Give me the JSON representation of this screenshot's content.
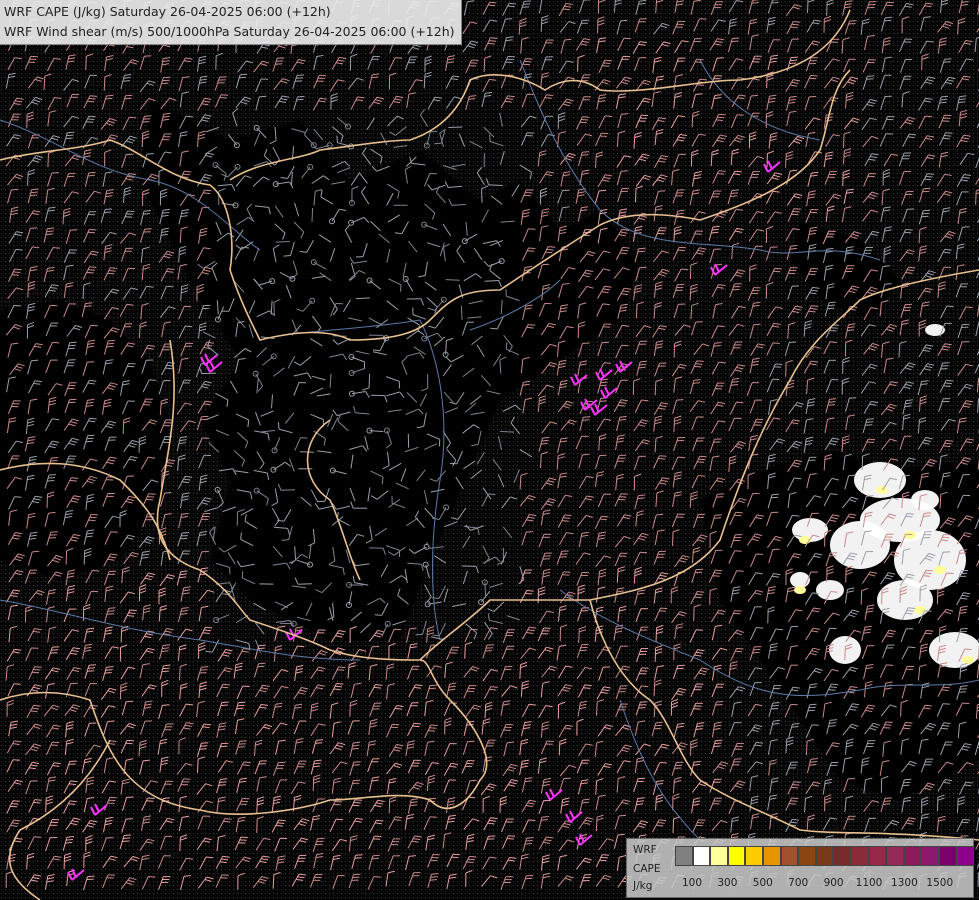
{
  "title": {
    "line1": "WRF CAPE (J/kg) Saturday 26-04-2025 06:00 (+12h)",
    "line2": "WRF Wind shear (m/s) 500/1000hPa Saturday 26-04-2025 06:00 (+12h)"
  },
  "legend": {
    "label_model": "WRF",
    "label_field": "CAPE",
    "label_unit": "J/kg",
    "ticks": [
      "100",
      "300",
      "500",
      "700",
      "900",
      "1100",
      "1300",
      "1500"
    ],
    "colors": [
      "#808080",
      "#ffffff",
      "#ffff99",
      "#ffff00",
      "#ffcc00",
      "#e69500",
      "#a0522d",
      "#8b4513",
      "#7a3a1a",
      "#7b2a2a",
      "#8b2a3a",
      "#962848",
      "#962858",
      "#8a1a5a",
      "#8a1a6e",
      "#7a006e",
      "#8b008b"
    ]
  },
  "map": {
    "background": "#050505",
    "border_color": "#e8c090",
    "river_color": "#5a7aaa",
    "barb_colors": {
      "weak": "#9aa0aa",
      "moderate": "#c98a8a",
      "strong": "#e8a0a0",
      "extreme": "#ff33ff"
    },
    "cape_low": "#ffffff",
    "cape_mid": "#ffff99"
  }
}
